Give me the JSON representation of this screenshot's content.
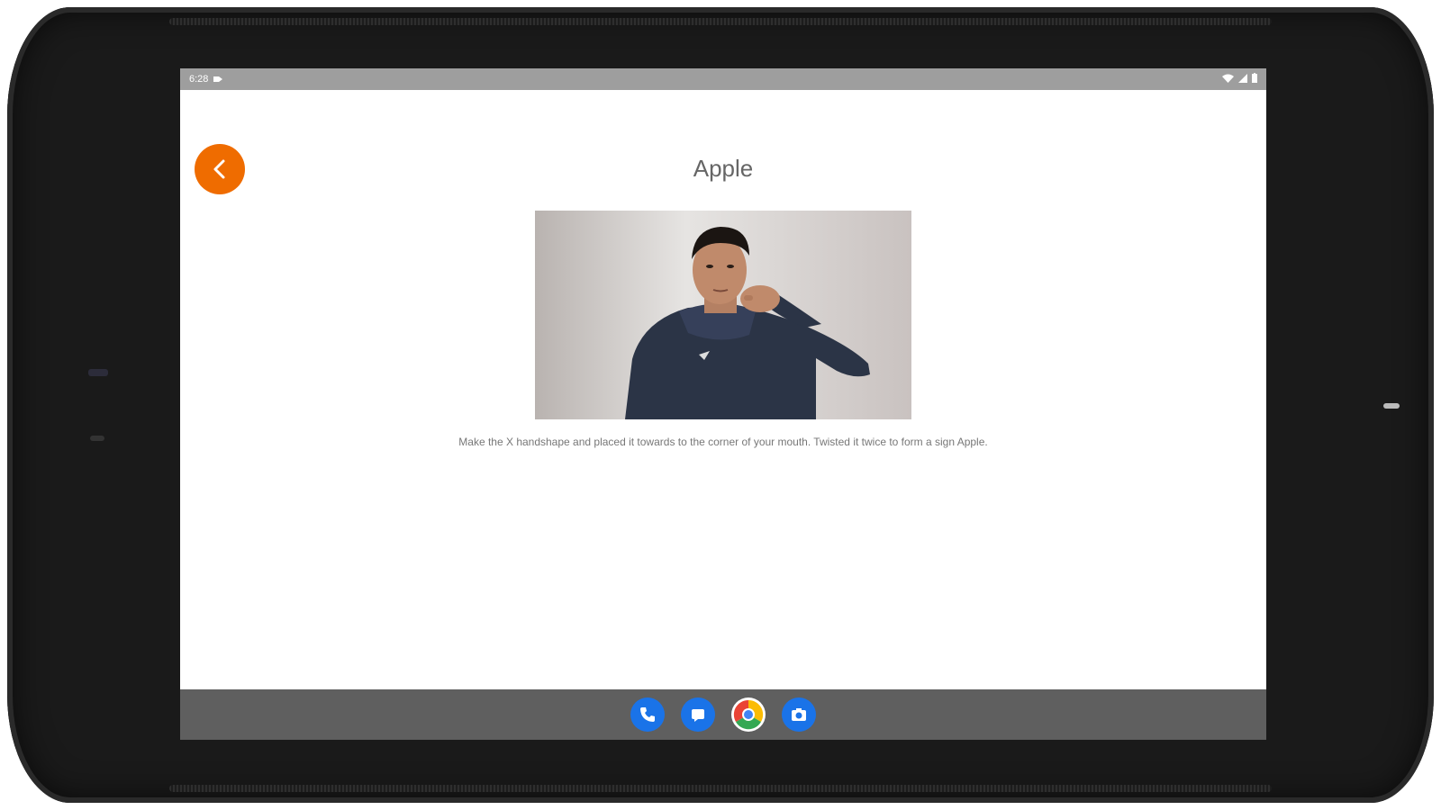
{
  "status_bar": {
    "time": "6:28",
    "icons": [
      "notification-icon",
      "wifi-icon",
      "signal-icon",
      "battery-icon"
    ]
  },
  "header": {
    "back_icon": "chevron-left-icon",
    "title": "Apple"
  },
  "content": {
    "image_subject": "person demonstrating Apple sign",
    "description": "Make the X handshape and placed it towards to the corner of your mouth. Twisted it twice to form a sign Apple."
  },
  "dock": {
    "apps": [
      {
        "name": "phone",
        "icon": "phone-icon"
      },
      {
        "name": "messages",
        "icon": "messages-icon"
      },
      {
        "name": "chrome",
        "icon": "chrome-icon"
      },
      {
        "name": "camera",
        "icon": "camera-icon"
      }
    ]
  },
  "colors": {
    "accent": "#ef6c00",
    "status_bar": "#9e9e9e",
    "nav_bar": "#5f5f5f",
    "dock_blue": "#1a73e8"
  }
}
